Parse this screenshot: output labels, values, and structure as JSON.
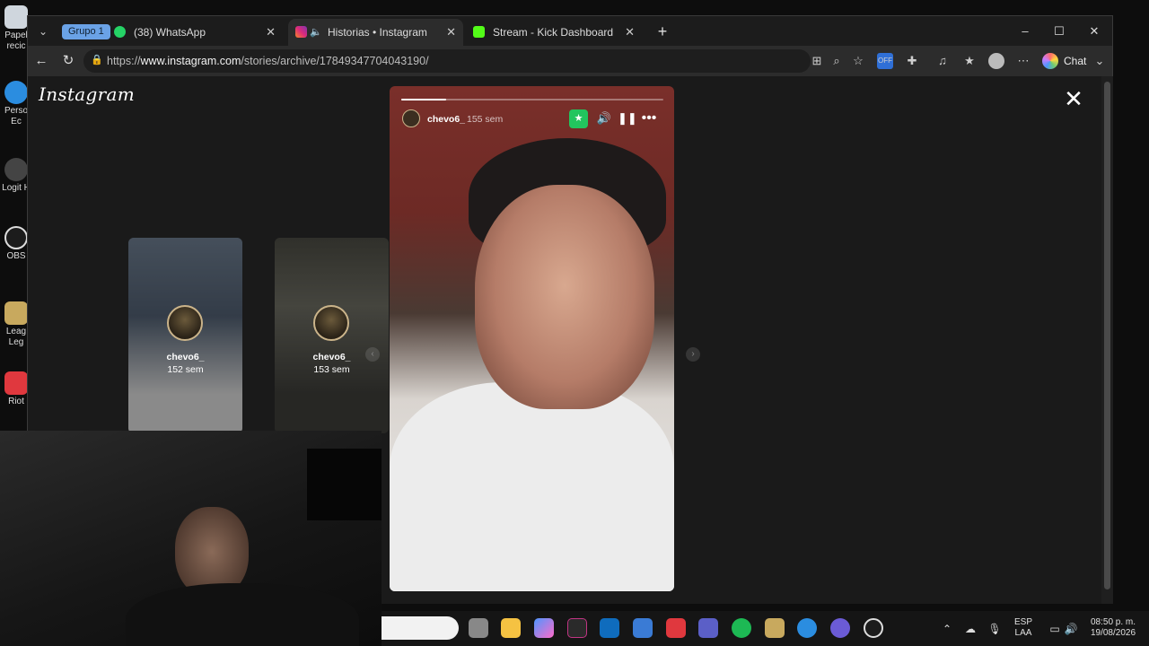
{
  "desktop": {
    "icons": [
      "Papel recic",
      "Perso Ec",
      "Logit H",
      "OBS",
      "Leag Leg",
      "Riot"
    ]
  },
  "tabstrip": {
    "group_label": "Grupo 1",
    "tabs": [
      {
        "label": "(38) WhatsApp",
        "badge": "38",
        "active": false,
        "color": "#25d366"
      },
      {
        "label": "Historias • Instagram",
        "active": true,
        "color": "#e1306c"
      },
      {
        "label": "Stream - Kick Dashboard",
        "active": false,
        "color": "#53fc18"
      }
    ],
    "new_tab": "+",
    "window_controls": [
      "–",
      "☐",
      "✕"
    ]
  },
  "toolbar": {
    "url_prefix": "https://",
    "url_host": "www.instagram.com",
    "url_path": "/stories/archive/17849347704043190/",
    "copilot_label": "Chat"
  },
  "page": {
    "logo": "Instagram",
    "close": "✕",
    "thumbnails": [
      {
        "name": "chevo6_",
        "ago": "152 sem"
      },
      {
        "name": "chevo6_",
        "ago": "153 sem"
      }
    ],
    "story": {
      "username": "chevo6_",
      "ago": "155 sem",
      "progress": 0.17,
      "accent": "#22c55e"
    }
  },
  "taskbar": {
    "lang": "ESP",
    "layout": "LAA",
    "time": "08:50 p. m.",
    "date": "19/08/2026"
  }
}
